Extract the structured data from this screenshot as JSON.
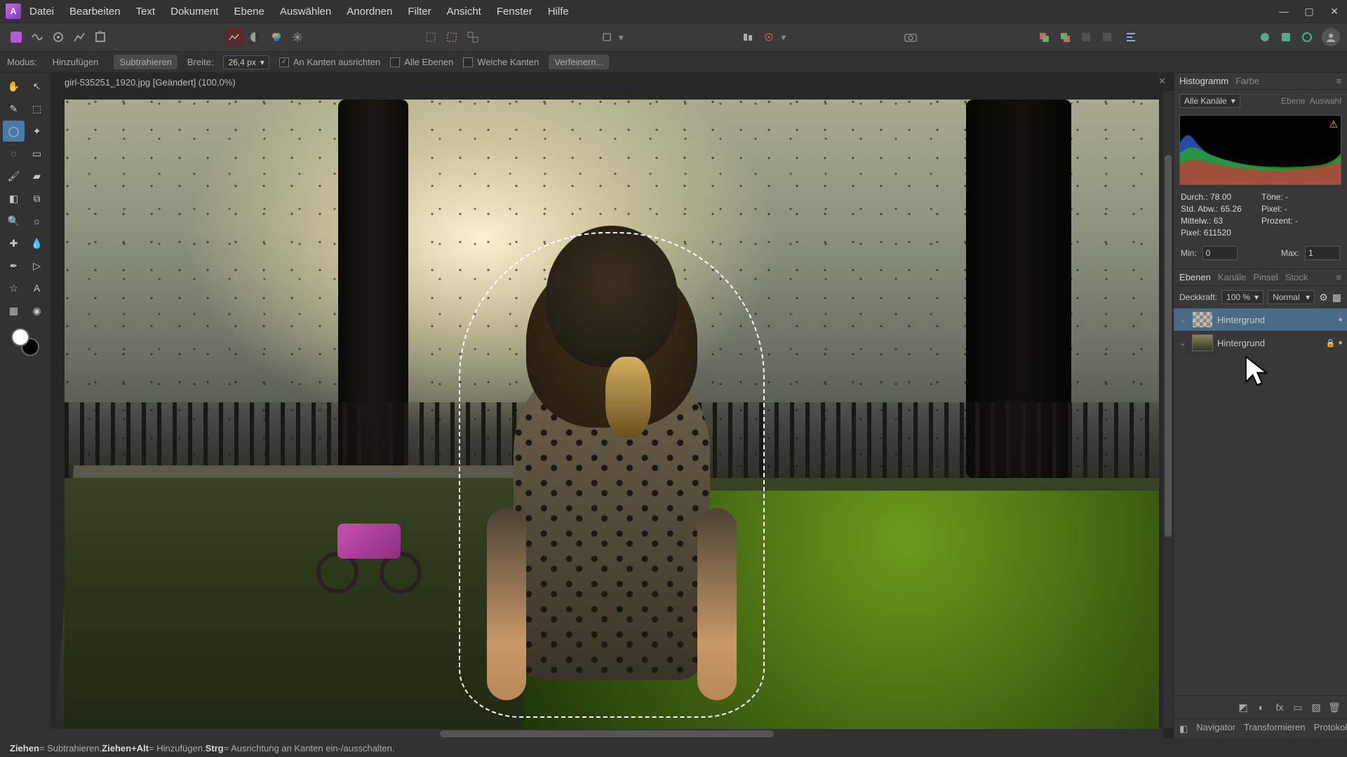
{
  "menu": {
    "datei": "Datei",
    "bearbeiten": "Bearbeiten",
    "text": "Text",
    "dokument": "Dokument",
    "ebene": "Ebene",
    "auswaehlen": "Auswählen",
    "anordnen": "Anordnen",
    "filter": "Filter",
    "ansicht": "Ansicht",
    "fenster": "Fenster",
    "hilfe": "Hilfe"
  },
  "optbar": {
    "mode_label": "Modus:",
    "add": "Hinzufügen",
    "subtract": "Subtrahieren",
    "width_label": "Breite:",
    "width_val": "26,4 px",
    "snap": "An Kanten ausrichten",
    "all_layers": "Alle Ebenen",
    "soft": "Weiche Kanten",
    "refine": "Verfeinern..."
  },
  "doc": {
    "title": "girl-535251_1920.jpg [Geändert] (100,0%)"
  },
  "rpanel": {
    "tab_histo": "Histogramm",
    "tab_color": "Farbe",
    "channels": "Alle Kanäle",
    "ebene_btn": "Ebene",
    "auswahl_btn": "Auswahl",
    "stat_mean": "Durch.:",
    "stat_mean_v": "78.00",
    "stat_std": "Std. Abw.:",
    "stat_std_v": "65.26",
    "stat_median": "Mittelw.:",
    "stat_median_v": "63",
    "stat_pixel": "Pixel:",
    "stat_pixel_v": "611520",
    "stat_tone": "Töne:",
    "stat_tone_v": "-",
    "stat_px": "Pixel:",
    "stat_px_v": "-",
    "stat_pct": "Prozent:",
    "stat_pct_v": "-",
    "min_label": "Min:",
    "min_v": "0",
    "max_label": "Max:",
    "max_v": "1",
    "tab_layers": "Ebenen",
    "tab_chan": "Kanäle",
    "tab_brush": "Pinsel",
    "tab_stock": "Stock",
    "opacity_label": "Deckkraft:",
    "opacity_v": "100 %",
    "blend": "Normal",
    "layer1": "Hintergrund",
    "layer2": "Hintergrund",
    "nav": "Navigator",
    "trans": "Transformieren",
    "proto": "Protokoll"
  },
  "status": {
    "t1": "Ziehen",
    "t1d": " = Subtrahieren. ",
    "t2": "Ziehen+Alt",
    "t2d": " = Hinzufügen. ",
    "t3": "Strg",
    "t3d": " = Ausrichtung an Kanten ein-/ausschalten."
  }
}
